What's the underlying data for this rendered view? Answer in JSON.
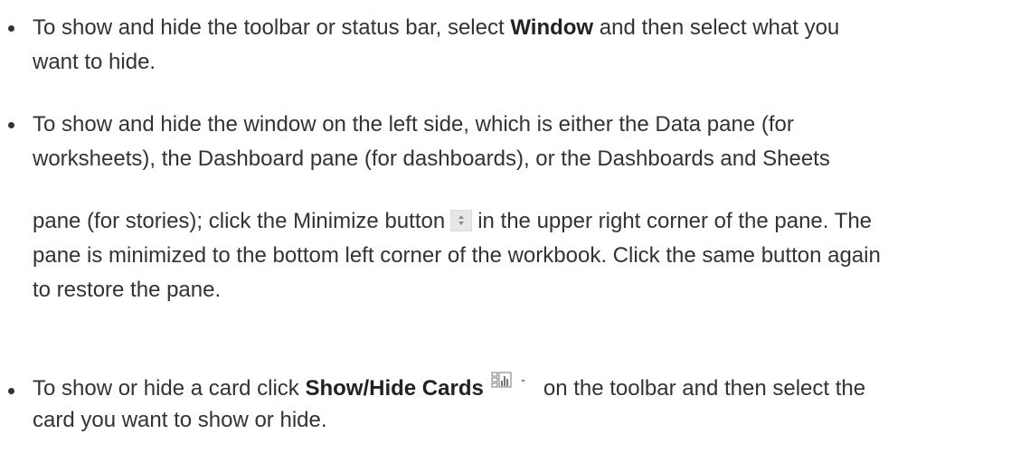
{
  "items": [
    {
      "lines": [
        {
          "before": "To show and hide the toolbar or status bar, select ",
          "bold": "Window",
          "after": " and then select what you"
        },
        {
          "text": "want to hide."
        }
      ]
    },
    {
      "lines": [
        {
          "text": "To show and hide the window on the left side, which is either the Data pane (for"
        },
        {
          "text": "worksheets), the Dashboard pane (for dashboards), or the Dashboards and Sheets"
        },
        {
          "before": "pane (for stories); click the Minimize button",
          "after": "in the upper right corner of the pane. The"
        },
        {
          "text": "pane is minimized to the bottom left corner of the workbook. Click the same button again"
        },
        {
          "text": "to restore the pane."
        }
      ]
    },
    {
      "lines": [
        {
          "before": "To show or hide a card click ",
          "bold": "Show/Hide Cards",
          "after": "on the toolbar and then select the"
        },
        {
          "text": "card you want to show or hide."
        }
      ]
    }
  ],
  "icons": {
    "minimize": "minimize-icon",
    "cards": "show-hide-cards-icon"
  }
}
